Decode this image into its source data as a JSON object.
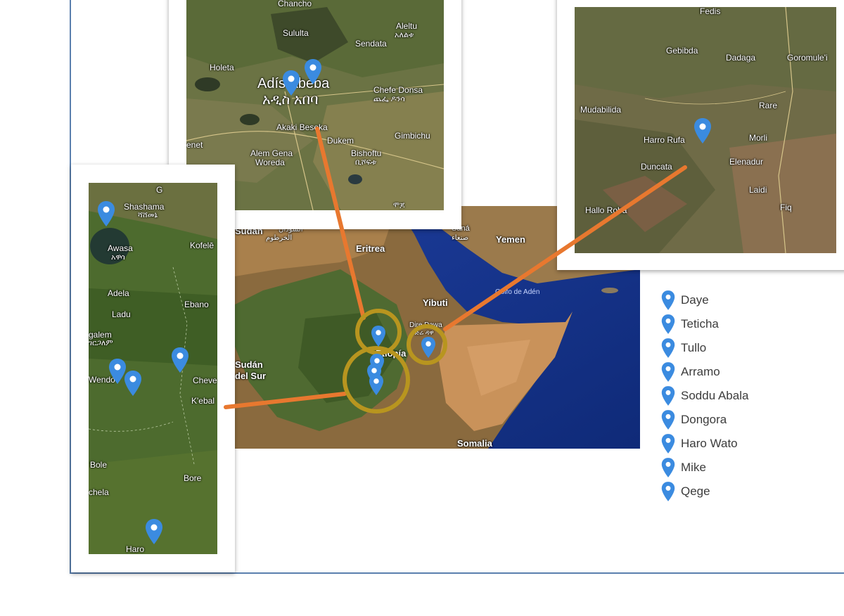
{
  "colors": {
    "pin": "#3b8be0",
    "connector": "#e8782f",
    "circle": "#b8951f",
    "frame": "#5a7fae"
  },
  "top_left_inset": {
    "labels": [
      "Chancho",
      "Sululta",
      "Aleltu",
      "አለልቱ",
      "Sendata",
      "Holeta",
      "Adís Abeba",
      "አዲስ አበባ",
      "Chefe Donsa",
      "ጨፌ ዶንሳ",
      "Akaki Beseka",
      "Gimbichu",
      "Dukem",
      "Bishoftu",
      "ቢሾፍቱ",
      "Alem Gena",
      "Woreda",
      "enet",
      "ሞጆ"
    ]
  },
  "top_right_inset": {
    "labels": [
      "Fedis",
      "Gebibda",
      "Dadaga",
      "Goromule'i",
      "Mudabilida",
      "Rare",
      "Harro Rufa",
      "Morli",
      "Duncata",
      "Elenadur",
      "Laidi",
      "Hallo Roba",
      "Fiq"
    ]
  },
  "left_inset": {
    "labels": [
      "Shashama",
      "ሻሸመኔ",
      "G",
      "Awasa",
      "አዋሳ",
      "Kofelē",
      "Adela",
      "Ebano",
      "Ladu",
      "galem",
      "ገርጋለም",
      "Wendo",
      "Cheve",
      "K'ebal",
      "Bole",
      "Bore",
      "chela",
      "Haro"
    ]
  },
  "main_map": {
    "labels": [
      "Sudan",
      "السودان",
      "الخرطوم",
      "Eritrea",
      "Saná",
      "صنعاء",
      "Yemen",
      "Golfo de Adén",
      "Yibuti",
      "Dire Dawa",
      "ድሬ ዳዋ",
      "Etiopía",
      "Sudán",
      "del Sur",
      "Somalia"
    ]
  },
  "legend": {
    "items": [
      "Daye",
      "Teticha",
      "Tullo",
      "Arramo",
      "Soddu Abala",
      "Dongora",
      "Haro Wato",
      "Mike",
      "Qege"
    ]
  }
}
